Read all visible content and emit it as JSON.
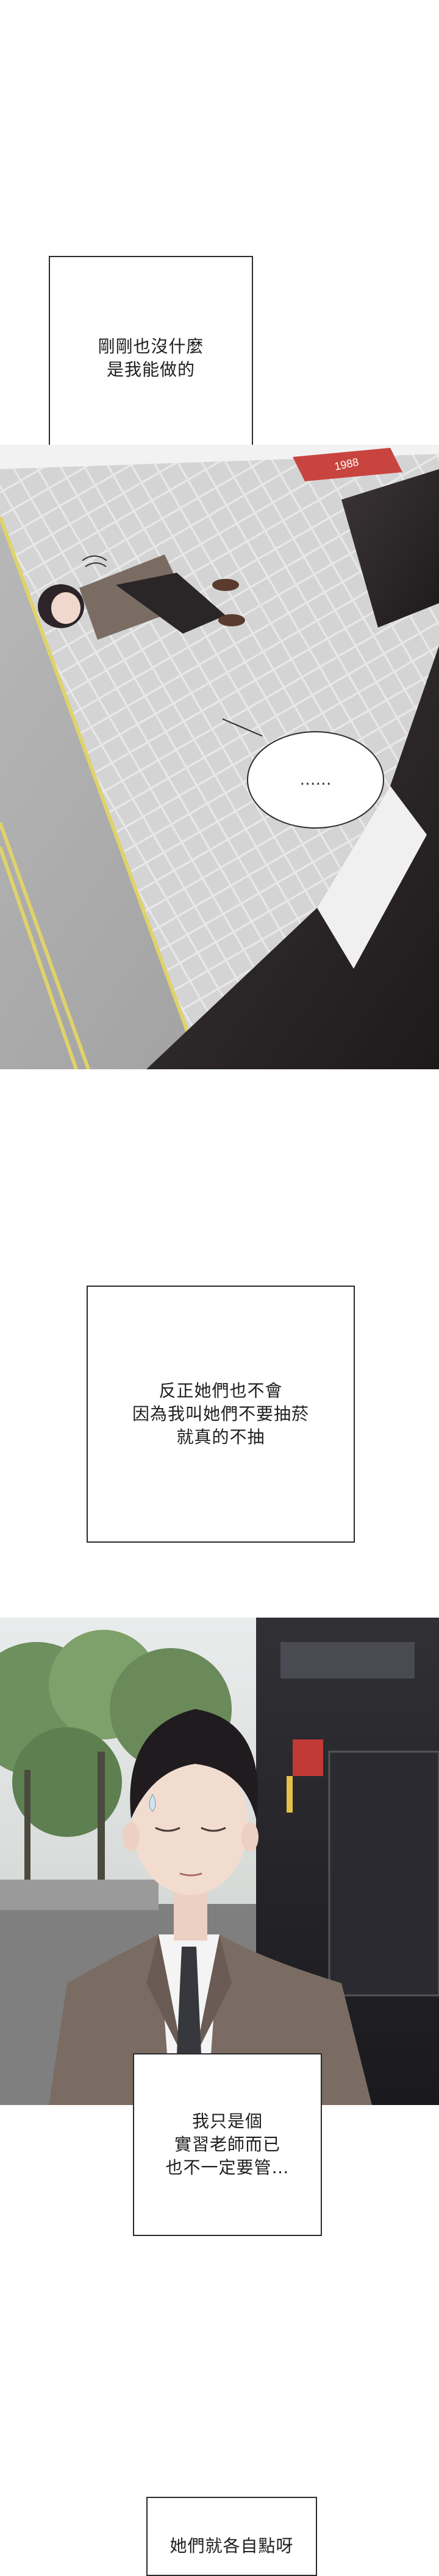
{
  "captions": {
    "c1": [
      "剛剛也沒什麼",
      "是我能做的"
    ],
    "c2": [
      "反正她們也不會",
      "因為我叫她們不要抽菸",
      "就真的不抽"
    ],
    "c3": [
      "我只是個",
      "實習老師而已",
      "也不一定要管…"
    ],
    "c4": [
      "她們就各自點呀"
    ]
  },
  "speech": {
    "ellipsis": "……"
  },
  "scene": {
    "street_sign": "1988",
    "colors": {
      "border": "#2a2a2a",
      "street_paving": "#d7d7d7",
      "yellow_line": "#e0d26a",
      "suit": "#7b6c63",
      "tie": "#36383d",
      "hair": "#1f1b1e"
    }
  }
}
